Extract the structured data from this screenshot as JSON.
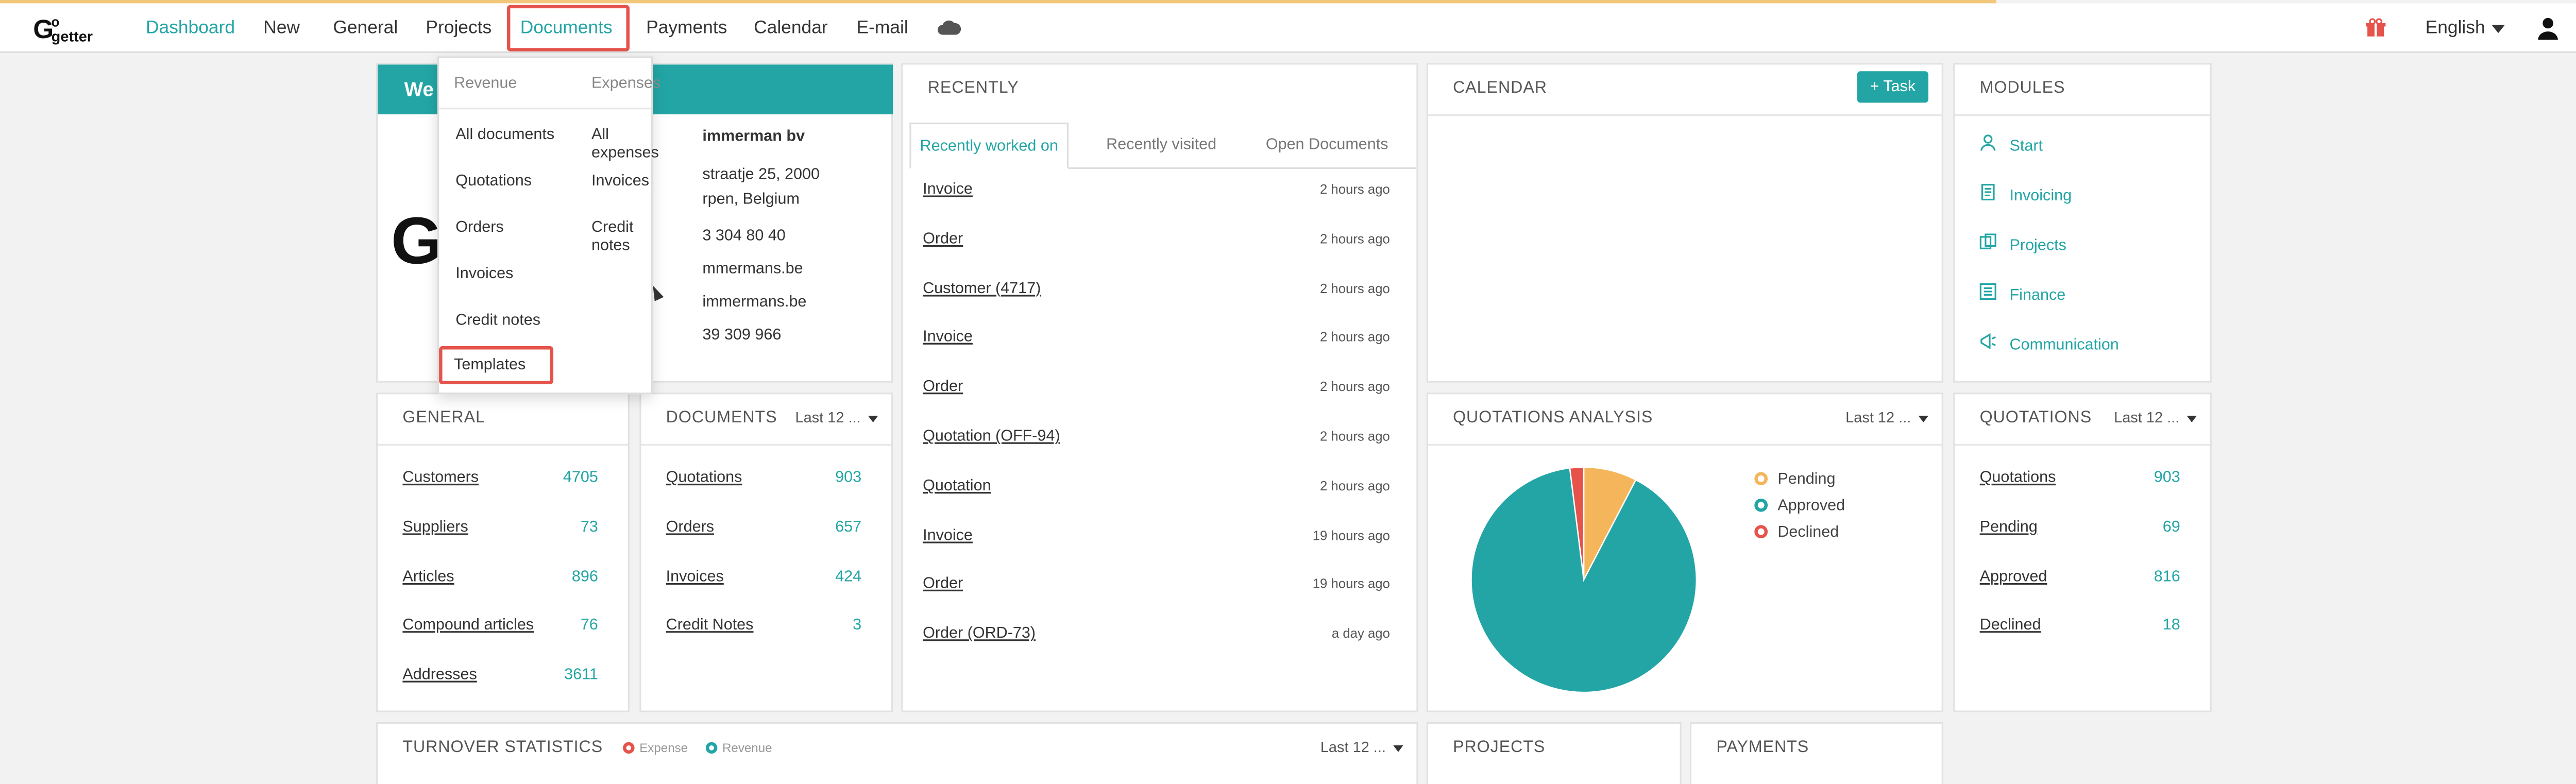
{
  "nav": {
    "items": [
      "Dashboard",
      "New",
      "General",
      "Projects",
      "Documents",
      "Payments",
      "Calendar",
      "E-mail"
    ],
    "language": "English"
  },
  "dropdown": {
    "col1_header": "Revenue",
    "col2_header": "Expenses",
    "col1": [
      "All documents",
      "Quotations",
      "Orders",
      "Invoices",
      "Credit notes",
      "Templates"
    ],
    "col2": [
      "All expenses",
      "Invoices",
      "Credit notes"
    ]
  },
  "welcome": {
    "title_fragment": "We",
    "company": "immerman bv",
    "address1": "straatje 25, 2000",
    "address2": "rpen, Belgium",
    "phone": "3 304 80 40",
    "email": "mmermans.be",
    "website": "immermans.be",
    "vat": "39 309 966"
  },
  "recently": {
    "title": "RECENTLY",
    "tabs": [
      "Recently worked on",
      "Recently visited",
      "Open Documents"
    ],
    "rows": [
      {
        "label": "Invoice",
        "time": "2 hours ago"
      },
      {
        "label": "Order",
        "time": "2 hours ago"
      },
      {
        "label": "Customer (4717)",
        "time": "2 hours ago"
      },
      {
        "label": "Invoice",
        "time": "2 hours ago"
      },
      {
        "label": "Order",
        "time": "2 hours ago"
      },
      {
        "label": "Quotation (OFF-94)",
        "time": "2 hours ago"
      },
      {
        "label": "Quotation",
        "time": "2 hours ago"
      },
      {
        "label": "Invoice",
        "time": "19 hours ago"
      },
      {
        "label": "Order",
        "time": "19 hours ago"
      },
      {
        "label": "Order (ORD-73)",
        "time": "a day ago"
      }
    ]
  },
  "calendar": {
    "title": "CALENDAR",
    "task_button": "+ Task"
  },
  "modules": {
    "title": "MODULES",
    "items": [
      {
        "label": "Start",
        "icon": "user-icon"
      },
      {
        "label": "Invoicing",
        "icon": "invoice-icon"
      },
      {
        "label": "Projects",
        "icon": "projects-icon"
      },
      {
        "label": "Finance",
        "icon": "finance-icon"
      },
      {
        "label": "Communication",
        "icon": "megaphone-icon"
      }
    ]
  },
  "general": {
    "title": "GENERAL",
    "rows": [
      {
        "label": "Customers",
        "value": "4705"
      },
      {
        "label": "Suppliers",
        "value": "73"
      },
      {
        "label": "Articles",
        "value": "896"
      },
      {
        "label": "Compound articles",
        "value": "76"
      },
      {
        "label": "Addresses",
        "value": "3611"
      }
    ]
  },
  "documents": {
    "title": "DOCUMENTS",
    "filter": "Last 12 ...",
    "rows": [
      {
        "label": "Quotations",
        "value": "903"
      },
      {
        "label": "Orders",
        "value": "657"
      },
      {
        "label": "Invoices",
        "value": "424"
      },
      {
        "label": "Credit Notes",
        "value": "3"
      }
    ]
  },
  "quotations_analysis": {
    "title": "QUOTATIONS ANALYSIS",
    "filter": "Last 12 ...",
    "legend": [
      {
        "label": "Pending",
        "color": "#f5b55a"
      },
      {
        "label": "Approved",
        "color": "#23a5a5"
      },
      {
        "label": "Declined",
        "color": "#e5534b"
      }
    ]
  },
  "chart_data": {
    "type": "pie",
    "categories": [
      "Pending",
      "Approved",
      "Declined"
    ],
    "values": [
      69,
      816,
      18
    ],
    "colors": [
      "#f5b55a",
      "#23a5a5",
      "#e5534b"
    ]
  },
  "quotations": {
    "title": "QUOTATIONS",
    "filter": "Last 12 ...",
    "rows": [
      {
        "label": "Quotations",
        "value": "903"
      },
      {
        "label": "Pending",
        "value": "69"
      },
      {
        "label": "Approved",
        "value": "816"
      },
      {
        "label": "Declined",
        "value": "18"
      }
    ]
  },
  "turnover": {
    "title": "TURNOVER STATISTICS",
    "legend": [
      {
        "label": "Expense",
        "color": "#e5534b"
      },
      {
        "label": "Revenue",
        "color": "#23a5a5"
      }
    ],
    "filter": "Last 12 ..."
  },
  "projects": {
    "title": "PROJECTS"
  },
  "payments": {
    "title": "PAYMENTS"
  },
  "colors": {
    "accent": "#23a5a5",
    "highlight": "#e5534b"
  }
}
